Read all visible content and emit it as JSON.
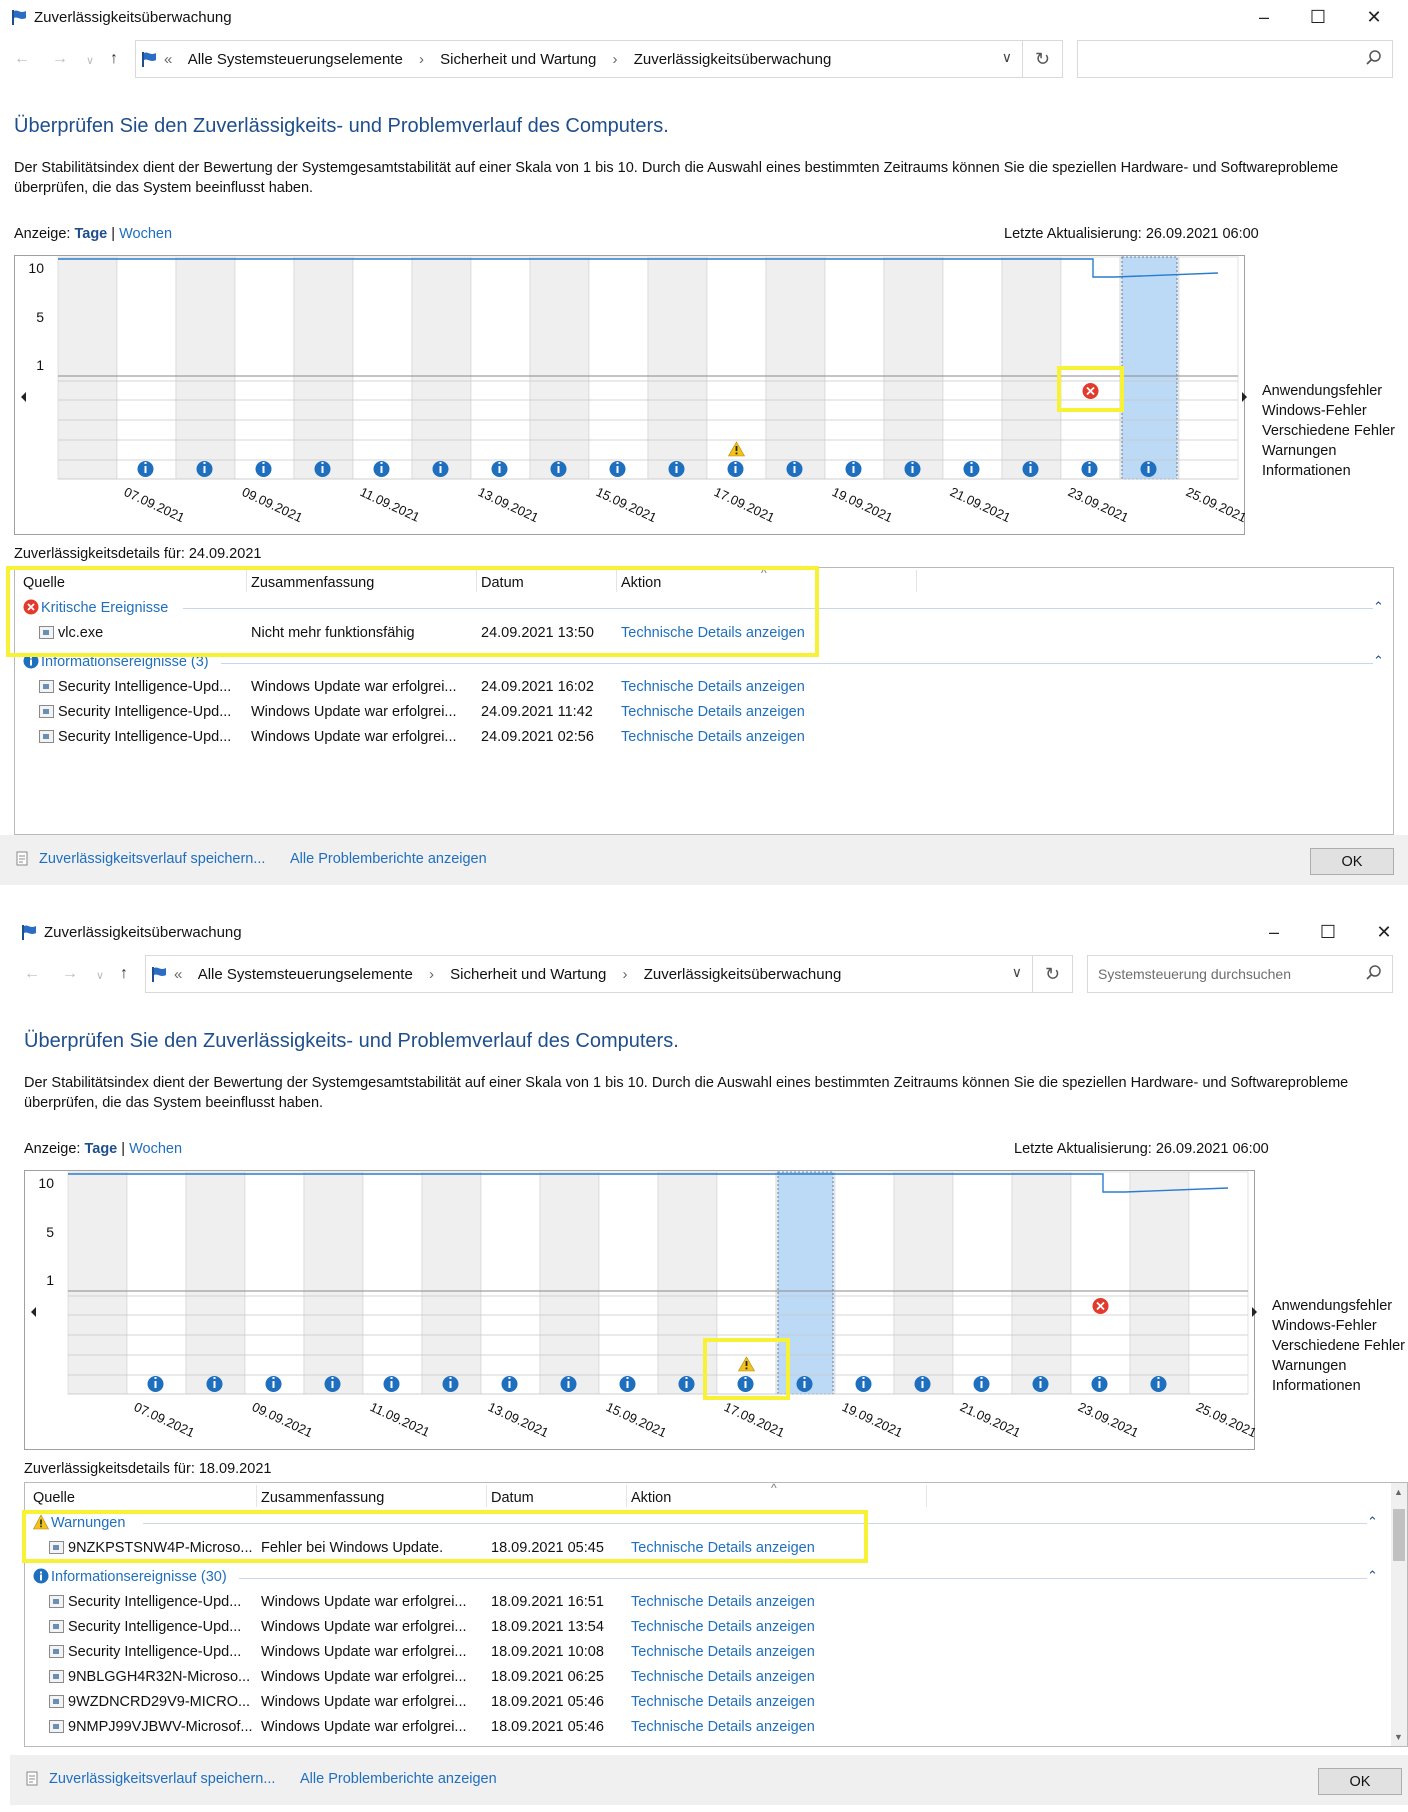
{
  "windows": [
    {
      "title": "Zuverlässigkeitsüberwachung",
      "breadcrumb": [
        "Alle Systemsteuerungselemente",
        "Sicherheit und Wartung",
        "Zuverlässigkeitsüberwachung"
      ],
      "breadcrumb_prefix": "«",
      "search_placeholder": "",
      "heading": "Überprüfen Sie den Zuverlässigkeits- und Problemverlauf des Computers.",
      "description": "Der Stabilitätsindex dient der Bewertung der Systemgesamtstabilität auf einer Skala von 1 bis 10. Durch die Auswahl eines bestimmten Zeitraums können Sie die speziellen Hardware- und Softwareprobleme überprüfen, die das System beeinflusst haben.",
      "view_label": "Anzeige:",
      "view_days": "Tage",
      "view_sep": "|",
      "view_weeks": "Wochen",
      "last_update": "Letzte Aktualisierung: 26.09.2021 06:00",
      "chart": {
        "y_ticks": [
          "10",
          "5",
          "1"
        ],
        "dates": [
          "07.09.2021",
          "09.09.2021",
          "11.09.2021",
          "13.09.2021",
          "15.09.2021",
          "17.09.2021",
          "19.09.2021",
          "21.09.2021",
          "23.09.2021",
          "25.09.2021"
        ],
        "categories": [
          "Anwendungsfehler",
          "Windows-Fehler",
          "Verschiedene Fehler",
          "Warnungen",
          "Informationen"
        ],
        "selected_date": "24.09.2021"
      },
      "details_title": "Zuverlässigkeitsdetails für: 24.09.2021",
      "columns": [
        "Quelle",
        "Zusammenfassung",
        "Datum",
        "Aktion"
      ],
      "groups": [
        {
          "title": "Kritische Ereignisse",
          "icon": "error-icon",
          "rows": [
            {
              "source": "vlc.exe",
              "summary": "Nicht mehr funktionsfähig",
              "date": "24.09.2021 13:50",
              "action": "Technische Details anzeigen"
            }
          ]
        },
        {
          "title": "Informationsereignisse (3)",
          "icon": "info-icon",
          "rows": [
            {
              "source": "Security Intelligence-Upd...",
              "summary": "Windows Update war erfolgrei...",
              "date": "24.09.2021 16:02",
              "action": "Technische Details anzeigen"
            },
            {
              "source": "Security Intelligence-Upd...",
              "summary": "Windows Update war erfolgrei...",
              "date": "24.09.2021 11:42",
              "action": "Technische Details anzeigen"
            },
            {
              "source": "Security Intelligence-Upd...",
              "summary": "Windows Update war erfolgrei...",
              "date": "24.09.2021 02:56",
              "action": "Technische Details anzeigen"
            }
          ]
        }
      ],
      "footer": {
        "save_link": "Zuverlässigkeitsverlauf speichern...",
        "reports_link": "Alle Problemberichte anzeigen",
        "ok": "OK"
      }
    },
    {
      "title": "Zuverlässigkeitsüberwachung",
      "breadcrumb": [
        "Alle Systemsteuerungselemente",
        "Sicherheit und Wartung",
        "Zuverlässigkeitsüberwachung"
      ],
      "breadcrumb_prefix": "«",
      "search_placeholder": "Systemsteuerung durchsuchen",
      "heading": "Überprüfen Sie den Zuverlässigkeits- und Problemverlauf des Computers.",
      "description": "Der Stabilitätsindex dient der Bewertung der Systemgesamtstabilität auf einer Skala von 1 bis 10. Durch die Auswahl eines bestimmten Zeitraums können Sie die speziellen Hardware- und Softwareprobleme überprüfen, die das System beeinflusst haben.",
      "view_label": "Anzeige:",
      "view_days": "Tage",
      "view_sep": "|",
      "view_weeks": "Wochen",
      "last_update": "Letzte Aktualisierung: 26.09.2021 06:00",
      "chart": {
        "y_ticks": [
          "10",
          "5",
          "1"
        ],
        "dates": [
          "07.09.2021",
          "09.09.2021",
          "11.09.2021",
          "13.09.2021",
          "15.09.2021",
          "17.09.2021",
          "19.09.2021",
          "21.09.2021",
          "23.09.2021",
          "25.09.2021"
        ],
        "categories": [
          "Anwendungsfehler",
          "Windows-Fehler",
          "Verschiedene Fehler",
          "Warnungen",
          "Informationen"
        ],
        "selected_date": "18.09.2021"
      },
      "details_title": "Zuverlässigkeitsdetails für: 18.09.2021",
      "columns": [
        "Quelle",
        "Zusammenfassung",
        "Datum",
        "Aktion"
      ],
      "groups": [
        {
          "title": "Warnungen",
          "icon": "warning-icon",
          "rows": [
            {
              "source": "9NZKPSTSNW4P-Microso...",
              "summary": "Fehler bei Windows Update.",
              "date": "18.09.2021 05:45",
              "action": "Technische Details anzeigen"
            }
          ]
        },
        {
          "title": "Informationsereignisse (30)",
          "icon": "info-icon",
          "rows": [
            {
              "source": "Security Intelligence-Upd...",
              "summary": "Windows Update war erfolgrei...",
              "date": "18.09.2021 16:51",
              "action": "Technische Details anzeigen"
            },
            {
              "source": "Security Intelligence-Upd...",
              "summary": "Windows Update war erfolgrei...",
              "date": "18.09.2021 13:54",
              "action": "Technische Details anzeigen"
            },
            {
              "source": "Security Intelligence-Upd...",
              "summary": "Windows Update war erfolgrei...",
              "date": "18.09.2021 10:08",
              "action": "Technische Details anzeigen"
            },
            {
              "source": "9NBLGGH4R32N-Microso...",
              "summary": "Windows Update war erfolgrei...",
              "date": "18.09.2021 06:25",
              "action": "Technische Details anzeigen"
            },
            {
              "source": "9WZDNCRD29V9-MICRO...",
              "summary": "Windows Update war erfolgrei...",
              "date": "18.09.2021 05:46",
              "action": "Technische Details anzeigen"
            },
            {
              "source": "9NMPJ99VJBWV-Microsof...",
              "summary": "Windows Update war erfolgrei...",
              "date": "18.09.2021 05:46",
              "action": "Technische Details anzeigen"
            }
          ]
        }
      ],
      "footer": {
        "save_link": "Zuverlässigkeitsverlauf speichern...",
        "reports_link": "Alle Problemberichte anzeigen",
        "ok": "OK"
      }
    }
  ],
  "colors": {
    "accent_link": "#1f6fbf",
    "heading": "#1f4e8c",
    "selected_column": "#bcd9f5",
    "highlight_box": "#f7f235",
    "error_red": "#e23b2e",
    "info_blue": "#1f6fbf",
    "warning_yellow": "#f4c21b"
  }
}
